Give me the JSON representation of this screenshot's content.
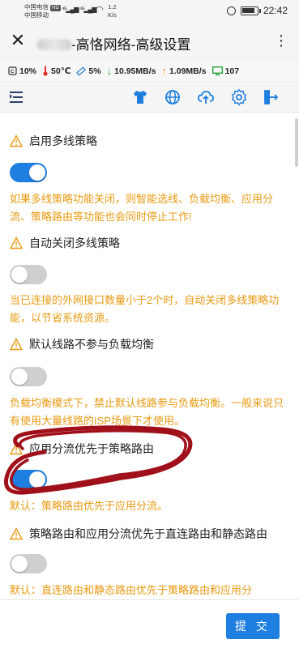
{
  "status_bar": {
    "carrier1": "中国电信",
    "carrier1_badge": "HD",
    "carrier2": "中国移动",
    "sig1": "⁴ᴳ▂▄▆",
    "sig2": "⁴ᴳ▂▄▆",
    "speed_value": "1.2",
    "speed_unit": "K/s",
    "time": "22:42"
  },
  "app_bar": {
    "title": "-高恪网络-高级设置",
    "more": "⋮"
  },
  "stats": {
    "cpu": "10%",
    "temp": "50℃",
    "mem": "5%",
    "down": "10.95MB/s",
    "up": "1.09MB/s",
    "devices": "107"
  },
  "toolbar": {
    "icons": [
      "menu-icon",
      "shirt-icon",
      "globe-icon",
      "cloud-upload-icon",
      "gear-icon",
      "logout-icon"
    ]
  },
  "settings": [
    {
      "label": "启用多线策略",
      "enabled": true,
      "desc": "如果多线策略功能关闭，则智能选线、负载均衡、应用分流、策略路由等功能也会同时停止工作!"
    },
    {
      "label": "自动关闭多线策略",
      "enabled": false,
      "desc": "当已连接的外网接口数量小于2个时，自动关闭多线策略功能，以节省系统资源。"
    },
    {
      "label": "默认线路不参与负载均衡",
      "enabled": false,
      "desc": "负载均衡模式下，禁止默认线路参与负载均衡。一般来说只有使用大量线路的ISP场景下才使用。"
    },
    {
      "label": "应用分流优先于策略路由",
      "enabled": true,
      "desc": "默认：策略路由优先于应用分流。"
    },
    {
      "label": "策略路由和应用分流优先于直连路由和静态路由",
      "enabled": false,
      "desc": "默认：直连路由和静态路由优先于策略路由和应用分"
    }
  ],
  "footer": {
    "submit_label": "提 交"
  },
  "colors": {
    "accent": "#1e7fe0",
    "warning_text": "#e89a12",
    "annotation": "#a0101a"
  }
}
